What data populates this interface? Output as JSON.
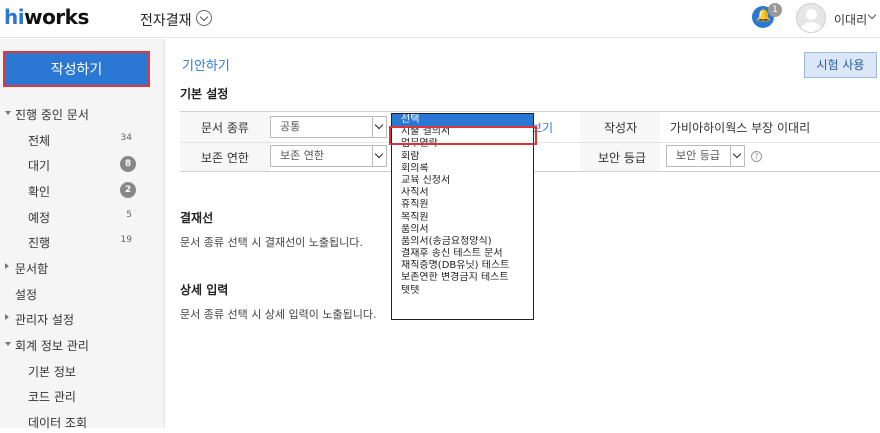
{
  "header": {
    "logo_hi": "hi",
    "logo_rest": "works",
    "app_title": "전자결재",
    "notification_count": "1",
    "user_name": "이대리"
  },
  "sidebar": {
    "write_button": "작성하기",
    "in_progress_group": "진행 중인 문서",
    "items": [
      {
        "label": "전체",
        "count": "34",
        "badge": false
      },
      {
        "label": "대기",
        "count": "8",
        "badge": true
      },
      {
        "label": "확인",
        "count": "2",
        "badge": true
      },
      {
        "label": "예정",
        "count": "5",
        "badge": false
      },
      {
        "label": "진행",
        "count": "19",
        "badge": false
      }
    ],
    "doc_box": "문서함",
    "settings": "설정",
    "admin_settings": "관리자 설정",
    "accounting": "회계 정보 관리",
    "accounting_items": [
      "기본 정보",
      "코드 관리",
      "데이터 조회"
    ]
  },
  "main": {
    "breadcrumb": "기안하기",
    "test_button": "시험 사용",
    "basic_settings": "기본 설정",
    "doc_type_label": "문서 종류",
    "doc_type_value": "공통",
    "retention_label": "보존 연한",
    "retention_value": "보존 연한",
    "partial_link": "보기",
    "author_label": "작성자",
    "author_value": "가비아하이웍스 부장 이대리",
    "security_label": "보안 등급",
    "security_value": "보안 등급",
    "approval_line_title": "결재선",
    "approval_line_desc": "문서 종류 선택 시 결재선이 노출됩니다.",
    "detail_input_title": "상세 입력",
    "detail_input_desc": "문서 종류 선택 시 상세 입력이 노출됩니다."
  },
  "dropdown": {
    "selected_index": 0,
    "highlighted_index": 1,
    "options": [
      "선택",
      "지출 결의서",
      "업무연락",
      "회람",
      "회의록",
      "교육 신청서",
      "사직서",
      "휴직원",
      "복직원",
      "품의서",
      "품의서(송금요청양식)",
      "결재후 송신 테스트 문서",
      "재직증명(DB유닛) 테스트",
      "보존연한 변경금지 테스트",
      "텟텟"
    ]
  },
  "colors": {
    "accent": "#2b78d4",
    "highlight_border": "#d8343a"
  }
}
